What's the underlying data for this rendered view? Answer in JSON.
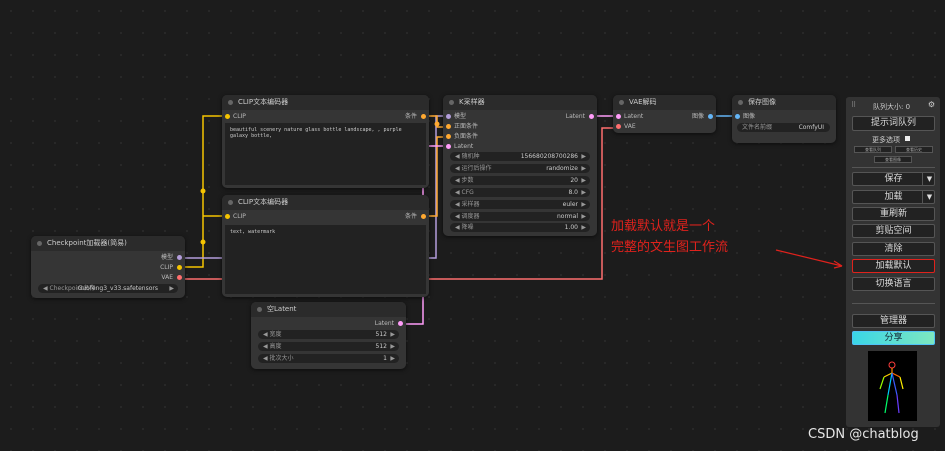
{
  "nodes": {
    "clip1": {
      "title": "CLIP文本编码器",
      "in_clip": "CLIP",
      "out_cond": "条件",
      "text": "beautiful scenery nature glass bottle landscape, , purple galaxy bottle,"
    },
    "clip2": {
      "title": "CLIP文本编码器",
      "in_clip": "CLIP",
      "out_cond": "条件",
      "text": "text, watermark"
    },
    "checkpoint": {
      "title": "Checkpoint加载器(简易)",
      "out_model": "模型",
      "out_clip": "CLIP",
      "out_vae": "VAE",
      "ckpt_label": "Checkpoint名称",
      "ckpt_value": "Guofeng3_v33.safetensors"
    },
    "latent": {
      "title": "空Latent",
      "out_latent": "Latent",
      "widgets": [
        {
          "label": "宽度",
          "value": "512"
        },
        {
          "label": "高度",
          "value": "512"
        },
        {
          "label": "批次大小",
          "value": "1"
        }
      ]
    },
    "ksampler": {
      "title": "K采样器",
      "in_model": "模型",
      "in_pos": "正面条件",
      "in_neg": "负面条件",
      "in_latent": "Latent",
      "out_latent": "Latent",
      "widgets": [
        {
          "label": "随机种",
          "value": "156680208700286"
        },
        {
          "label": "运行后操作",
          "value": "randomize"
        },
        {
          "label": "步数",
          "value": "20"
        },
        {
          "label": "CFG",
          "value": "8.0"
        },
        {
          "label": "采样器",
          "value": "euler"
        },
        {
          "label": "调度器",
          "value": "normal"
        },
        {
          "label": "降噪",
          "value": "1.00"
        }
      ]
    },
    "vaedecode": {
      "title": "VAE解码",
      "in_latent": "Latent",
      "in_vae": "VAE",
      "out_image": "图像"
    },
    "save": {
      "title": "保存图像",
      "in_image": "图像",
      "prefix_label": "文件名前缀",
      "prefix_value": "ComfyUI"
    }
  },
  "panel": {
    "queue_size": "队列大小: 0",
    "queue_prompt": "提示词队列",
    "extra_options": "更多选项",
    "small_btns": [
      "查看队列",
      "查看历史",
      "查看图像"
    ],
    "save": "保存",
    "load": "加载",
    "refresh": "重刷新",
    "clipspace": "剪贴空间",
    "clear": "清除",
    "load_default": "加载默认",
    "switch_lang": "切换语言",
    "manager": "管理器",
    "share": "分享"
  },
  "annotation": {
    "line1": "加载默认就是一个",
    "line2": "完整的文生图工作流"
  },
  "watermark": "CSDN @chatblog",
  "colors": {
    "clip_wire": "#f5c400",
    "model_wire": "#b39ddb",
    "vae_wire": "#ff6e6e",
    "latent_wire": "#ff9cf9",
    "cond_wire": "#ffa931",
    "image_wire": "#64b5f6",
    "annotation": "#e0221c",
    "share_btn": "#4fc3f7"
  }
}
